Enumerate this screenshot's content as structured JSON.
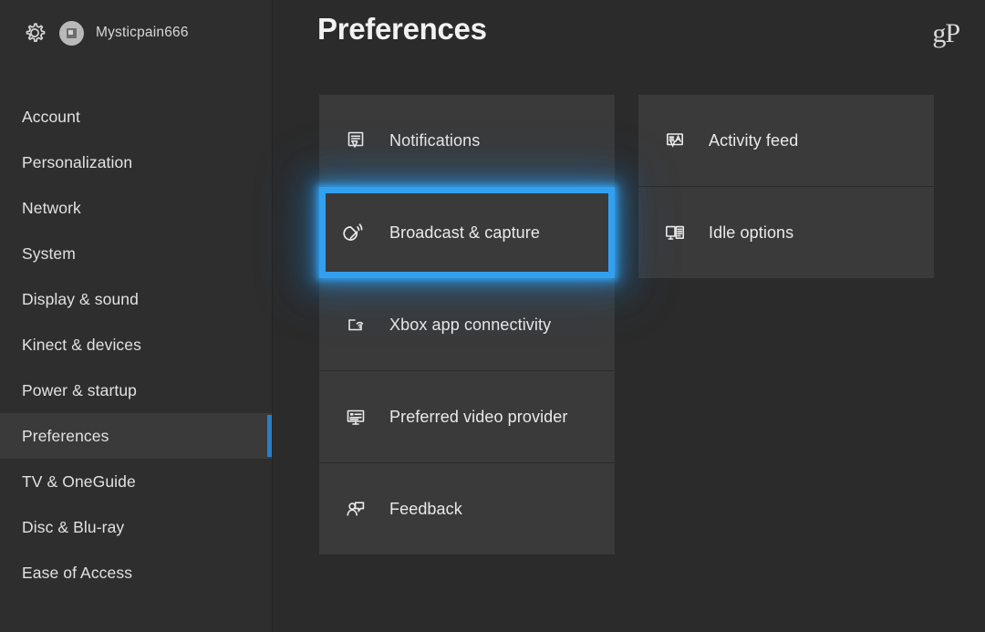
{
  "window": {
    "background_color": "#2b2b2b",
    "accent_color": "#33a0ef",
    "tile_color": "#3a3a3a"
  },
  "sidebar": {
    "profile": {
      "gear_icon": "gear-icon",
      "avatar_icon": "avatar",
      "gamertag": "Mysticpain666"
    },
    "items": [
      {
        "label": "Account",
        "selected": false
      },
      {
        "label": "Personalization",
        "selected": false
      },
      {
        "label": "Network",
        "selected": false
      },
      {
        "label": "System",
        "selected": false
      },
      {
        "label": "Display & sound",
        "selected": false
      },
      {
        "label": "Kinect & devices",
        "selected": false
      },
      {
        "label": "Power & startup",
        "selected": false
      },
      {
        "label": "Preferences",
        "selected": true
      },
      {
        "label": "TV & OneGuide",
        "selected": false
      },
      {
        "label": "Disc & Blu-ray",
        "selected": false
      },
      {
        "label": "Ease of Access",
        "selected": false
      }
    ]
  },
  "header": {
    "title": "Preferences",
    "watermark": "gP"
  },
  "main": {
    "columns": [
      {
        "tiles": [
          {
            "label": "Notifications",
            "icon": "notification-bubble-icon",
            "highlighted": false
          },
          {
            "label": "Broadcast & capture",
            "icon": "satellite-dish-icon",
            "highlighted": true
          },
          {
            "label": "Xbox app connectivity",
            "icon": "console-wifi-icon",
            "highlighted": false
          },
          {
            "label": "Preferred video provider",
            "icon": "monitor-video-icon",
            "highlighted": false
          },
          {
            "label": "Feedback",
            "icon": "person-speech-bubble-icon",
            "highlighted": false
          }
        ]
      },
      {
        "tiles": [
          {
            "label": "Activity feed",
            "icon": "feed-bubble-icon",
            "highlighted": false
          },
          {
            "label": "Idle options",
            "icon": "monitor-panel-icon",
            "highlighted": false
          }
        ]
      }
    ]
  }
}
